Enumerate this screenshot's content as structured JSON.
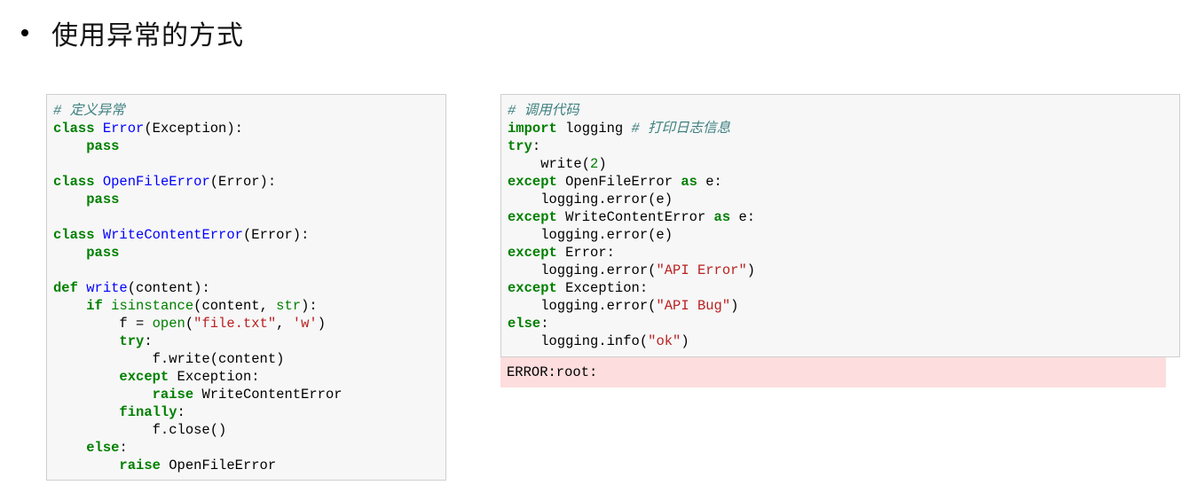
{
  "heading": {
    "bullet": "•",
    "text": "使用异常的方式"
  },
  "colors": {
    "keyword": "#008000",
    "builtin": "#008000",
    "name": "#0000ff",
    "string": "#ba2121",
    "comment": "#408080",
    "code_background": "#f7f7f7",
    "error_background": "#fddddd"
  },
  "left_cell": {
    "lines": [
      [
        {
          "t": "# 定义异常",
          "c": "cm"
        }
      ],
      [
        {
          "t": "class",
          "c": "kw"
        },
        {
          "t": " "
        },
        {
          "t": "Error",
          "c": "nm"
        },
        {
          "t": "(Exception):"
        }
      ],
      [
        {
          "t": "    "
        },
        {
          "t": "pass",
          "c": "kw"
        }
      ],
      [],
      [
        {
          "t": "class",
          "c": "kw"
        },
        {
          "t": " "
        },
        {
          "t": "OpenFileError",
          "c": "nm"
        },
        {
          "t": "(Error):"
        }
      ],
      [
        {
          "t": "    "
        },
        {
          "t": "pass",
          "c": "kw"
        }
      ],
      [],
      [
        {
          "t": "class",
          "c": "kw"
        },
        {
          "t": " "
        },
        {
          "t": "WriteContentError",
          "c": "nm"
        },
        {
          "t": "(Error):"
        }
      ],
      [
        {
          "t": "    "
        },
        {
          "t": "pass",
          "c": "kw"
        }
      ],
      [],
      [
        {
          "t": "def",
          "c": "kw"
        },
        {
          "t": " "
        },
        {
          "t": "write",
          "c": "nm"
        },
        {
          "t": "(content):"
        }
      ],
      [
        {
          "t": "    "
        },
        {
          "t": "if",
          "c": "kw"
        },
        {
          "t": " "
        },
        {
          "t": "isinstance",
          "c": "bi"
        },
        {
          "t": "(content, "
        },
        {
          "t": "str",
          "c": "bi"
        },
        {
          "t": "):"
        }
      ],
      [
        {
          "t": "        f = "
        },
        {
          "t": "open",
          "c": "bi"
        },
        {
          "t": "("
        },
        {
          "t": "\"file.txt\"",
          "c": "st"
        },
        {
          "t": ", "
        },
        {
          "t": "'w'",
          "c": "st"
        },
        {
          "t": ")"
        }
      ],
      [
        {
          "t": "        "
        },
        {
          "t": "try",
          "c": "kw"
        },
        {
          "t": ":"
        }
      ],
      [
        {
          "t": "            f.write(content)"
        }
      ],
      [
        {
          "t": "        "
        },
        {
          "t": "except",
          "c": "kw"
        },
        {
          "t": " Exception:"
        }
      ],
      [
        {
          "t": "            "
        },
        {
          "t": "raise",
          "c": "kw"
        },
        {
          "t": " WriteContentError"
        }
      ],
      [
        {
          "t": "        "
        },
        {
          "t": "finally",
          "c": "kw"
        },
        {
          "t": ":"
        }
      ],
      [
        {
          "t": "            f.close()"
        }
      ],
      [
        {
          "t": "    "
        },
        {
          "t": "else",
          "c": "kw"
        },
        {
          "t": ":"
        }
      ],
      [
        {
          "t": "        "
        },
        {
          "t": "raise",
          "c": "kw"
        },
        {
          "t": " OpenFileError"
        }
      ]
    ]
  },
  "right_cell": {
    "lines": [
      [
        {
          "t": "# 调用代码",
          "c": "cm"
        }
      ],
      [
        {
          "t": "import",
          "c": "kw"
        },
        {
          "t": " logging "
        },
        {
          "t": "# 打印日志信息",
          "c": "cm"
        }
      ],
      [
        {
          "t": "try",
          "c": "kw"
        },
        {
          "t": ":"
        }
      ],
      [
        {
          "t": "    write("
        },
        {
          "t": "2",
          "c": "num"
        },
        {
          "t": ")"
        }
      ],
      [
        {
          "t": "except",
          "c": "kw"
        },
        {
          "t": " OpenFileError "
        },
        {
          "t": "as",
          "c": "kw"
        },
        {
          "t": " e:"
        }
      ],
      [
        {
          "t": "    logging.error(e)"
        }
      ],
      [
        {
          "t": "except",
          "c": "kw"
        },
        {
          "t": " WriteContentError "
        },
        {
          "t": "as",
          "c": "kw"
        },
        {
          "t": " e:"
        }
      ],
      [
        {
          "t": "    logging.error(e)"
        }
      ],
      [
        {
          "t": "except",
          "c": "kw"
        },
        {
          "t": " Error:"
        }
      ],
      [
        {
          "t": "    logging.error("
        },
        {
          "t": "\"API Error\"",
          "c": "st"
        },
        {
          "t": ")"
        }
      ],
      [
        {
          "t": "except",
          "c": "kw"
        },
        {
          "t": " Exception:"
        }
      ],
      [
        {
          "t": "    logging.error("
        },
        {
          "t": "\"API Bug\"",
          "c": "st"
        },
        {
          "t": ")"
        }
      ],
      [
        {
          "t": "else",
          "c": "kw"
        },
        {
          "t": ":"
        }
      ],
      [
        {
          "t": "    logging.info("
        },
        {
          "t": "\"ok\"",
          "c": "st"
        },
        {
          "t": ")"
        }
      ]
    ],
    "output": "ERROR:root:"
  }
}
